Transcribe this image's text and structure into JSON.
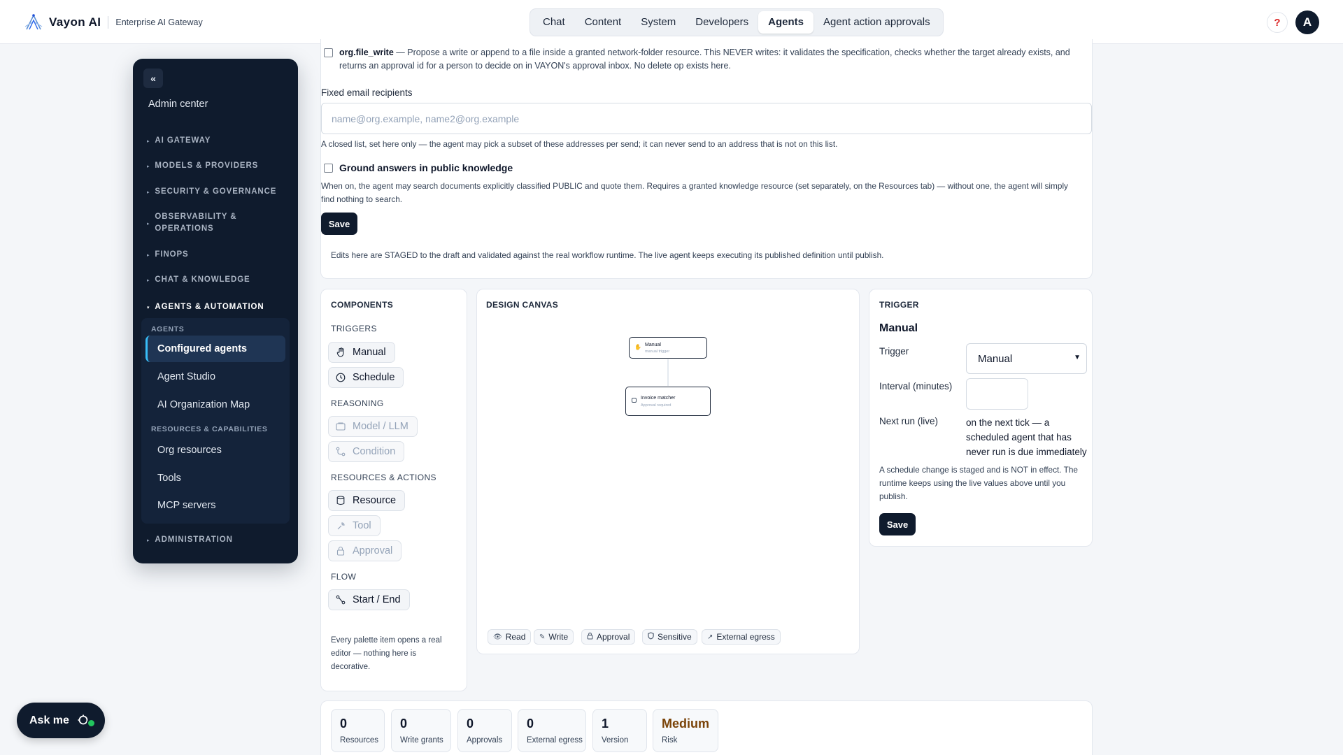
{
  "topbar": {
    "brand_name": "Vayon AI",
    "brand_sub": "Enterprise AI Gateway",
    "tabs": [
      {
        "label": "Chat"
      },
      {
        "label": "Content"
      },
      {
        "label": "System"
      },
      {
        "label": "Developers"
      },
      {
        "label": "Agents"
      },
      {
        "label": "Agent action approvals"
      }
    ],
    "active_tab": "Agents",
    "help_icon": "?",
    "avatar_initial": "A"
  },
  "sidebar": {
    "collapse_glyph": "«",
    "title": "Admin center",
    "sections": [
      {
        "label": "AI GATEWAY"
      },
      {
        "label": "MODELS & PROVIDERS"
      },
      {
        "label": "SECURITY & GOVERNANCE"
      },
      {
        "label": "OBSERVABILITY & OPERATIONS"
      },
      {
        "label": "FINOPS"
      },
      {
        "label": "CHAT & KNOWLEDGE"
      },
      {
        "label": "AGENTS & AUTOMATION"
      },
      {
        "label": "ADMINISTRATION"
      }
    ],
    "group": {
      "sub1": "AGENTS",
      "items1": [
        "Configured agents",
        "Agent Studio",
        "AI Organization Map"
      ],
      "sub2": "RESOURCES & CAPABILITIES",
      "items2": [
        "Org resources",
        "Tools",
        "MCP servers"
      ]
    },
    "active_item": "Configured agents"
  },
  "top_panel": {
    "file_write_name": "org.file_write",
    "file_write_desc": " — Propose a write or append to a file inside a granted network-folder resource. This NEVER writes: it validates the specification, checks whether the target already exists, and returns an approval id for a person to decide on in VAYON's approval inbox. No delete op exists here.",
    "email_label": "Fixed email recipients",
    "email_placeholder": "name@org.example, name2@org.example",
    "email_help": "A closed list, set here only — the agent may pick a subset of these addresses per send; it can never send to an address that is not on this list.",
    "ground_label": "Ground answers in public knowledge",
    "ground_help": "When on, the agent may search documents explicitly classified PUBLIC and quote them. Requires a granted knowledge resource (set separately, on the Resources tab) — without one, the agent will simply find nothing to search.",
    "save_label": "Save",
    "staged_note": "Edits here are STAGED to the draft and validated against the real workflow runtime. The live agent keeps executing its published definition until publish."
  },
  "components": {
    "title": "COMPONENTS",
    "categories": [
      {
        "label": "TRIGGERS",
        "items": [
          {
            "label": "Manual",
            "icon": "hand-icon",
            "disabled": false
          },
          {
            "label": "Schedule",
            "icon": "clock-icon",
            "disabled": false
          }
        ]
      },
      {
        "label": "REASONING",
        "items": [
          {
            "label": "Model / LLM",
            "icon": "box-icon",
            "disabled": true
          },
          {
            "label": "Condition",
            "icon": "branch-icon",
            "disabled": true
          }
        ]
      },
      {
        "label": "RESOURCES & ACTIONS",
        "items": [
          {
            "label": "Resource",
            "icon": "database-icon",
            "disabled": false
          },
          {
            "label": "Tool",
            "icon": "wrench-icon",
            "disabled": true
          },
          {
            "label": "Approval",
            "icon": "lock-icon",
            "disabled": true
          }
        ]
      },
      {
        "label": "FLOW",
        "items": [
          {
            "label": "Start / End",
            "icon": "flow-icon",
            "disabled": false
          }
        ]
      }
    ],
    "footer_note": "Every palette item opens a real editor — nothing here is decorative."
  },
  "canvas": {
    "title": "DESIGN CANVAS",
    "nodes": [
      {
        "title": "Manual",
        "subtitle": "manual trigger"
      },
      {
        "title": "Invoice matcher",
        "subtitle": "Approval required"
      }
    ],
    "legend": [
      {
        "label": "Read",
        "icon": "eye-icon"
      },
      {
        "label": "Write",
        "icon": "pencil-icon"
      },
      {
        "label": "Approval",
        "icon": "lock-icon"
      },
      {
        "label": "Sensitive",
        "icon": "shield-icon"
      },
      {
        "label": "External egress",
        "icon": "arrow-up-right-icon"
      }
    ]
  },
  "trigger": {
    "title": "TRIGGER",
    "heading": "Manual",
    "trigger_label": "Trigger",
    "trigger_value": "Manual",
    "interval_label": "Interval (minutes)",
    "interval_value": "",
    "next_run_label": "Next run (live)",
    "next_run_value": "on the next tick — a scheduled agent that has never run is due immediately",
    "note": "A schedule change is staged and is NOT in effect. The runtime keeps using the live values above until you publish.",
    "save_label": "Save"
  },
  "stats": [
    {
      "value": "0",
      "label": "Resources"
    },
    {
      "value": "0",
      "label": "Write grants"
    },
    {
      "value": "0",
      "label": "Approvals"
    },
    {
      "value": "0",
      "label": "External egress"
    },
    {
      "value": "1",
      "label": "Version"
    },
    {
      "value": "Medium",
      "label": "Risk"
    }
  ],
  "ask_me": {
    "label": "Ask me"
  },
  "colors": {
    "navy": "#0f1b2d",
    "accent": "#38bdf8",
    "risk_medium": "#7a4308",
    "online": "#22c55e"
  }
}
